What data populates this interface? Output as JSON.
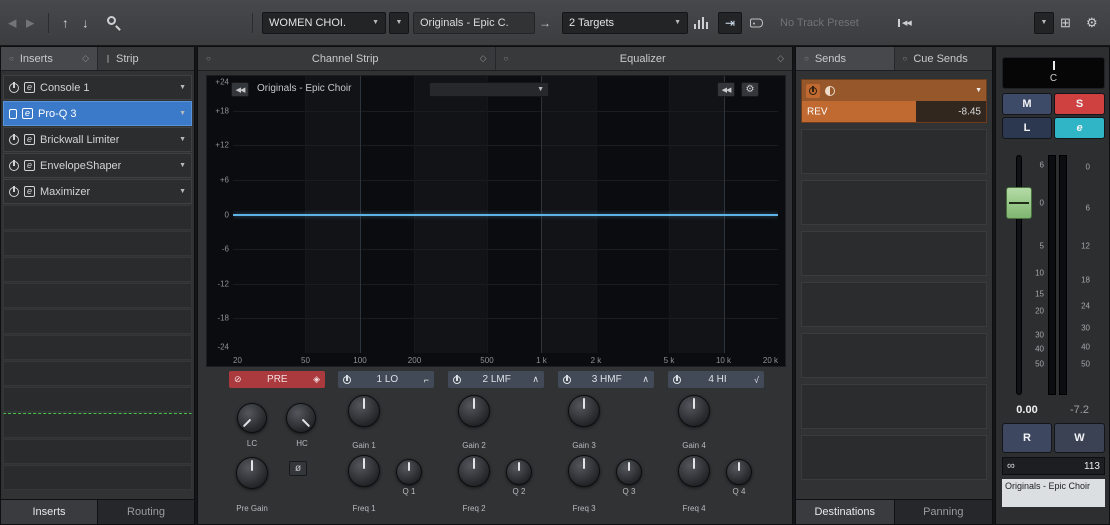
{
  "colors": {
    "selected_insert": "#3b79c9",
    "send_orange": "#c06a32",
    "send_orange_dark": "#96572b",
    "pre_red": "#aa3a3e",
    "eq_line": "#5fb3e4",
    "solo_red": "#cf4040",
    "mute_blue": "#3d4a68",
    "edit_cyan": "#2fb5c5",
    "fader_green": "#93ca85"
  },
  "icons": {
    "back": "◀",
    "forward": "▶",
    "up": "↑",
    "down": "↓",
    "dropdown": "▼",
    "arrow_right": "→",
    "insert_arrow": "⇥",
    "gear": "⚙",
    "skip_back": "◀◀",
    "circle": "○",
    "diamond": "◇",
    "strip": "∥",
    "e_btn": "e",
    "phase": "ø",
    "band_lo": "⌐",
    "band_peak": "∧",
    "band_hi": "√",
    "pre_bypass": "⊘",
    "pre_ab": "◈",
    "stereo": "∞",
    "window": "⊞"
  },
  "toolbar": {
    "channel_select": "WOMEN CHOI.",
    "preset_field": "Originals - Epic C.",
    "targets_select": "2 Targets",
    "no_track_preset": "No Track Preset"
  },
  "left_panel": {
    "tab_inserts": "Inserts",
    "tab_strip": "Strip",
    "inserts": [
      {
        "label": "Console 1"
      },
      {
        "label": "Pro-Q 3"
      },
      {
        "label": "Brickwall Limiter"
      },
      {
        "label": "EnvelopeShaper"
      },
      {
        "label": "Maximizer"
      }
    ],
    "bottom_tab_inserts": "Inserts",
    "bottom_tab_routing": "Routing"
  },
  "center_panel": {
    "tab_channel_strip": "Channel Strip",
    "tab_equalizer": "Equalizer",
    "eq_preset_label": "Originals - Epic Choir",
    "y_labels": [
      "+24",
      "+18",
      "+12",
      "+6",
      "0",
      "-6",
      "-12",
      "-18",
      "-24"
    ],
    "x_labels": [
      "20",
      "50",
      "100",
      "200",
      "500",
      "1 k",
      "2 k",
      "5 k",
      "10 k",
      "20 k"
    ],
    "pre": {
      "header": "PRE",
      "lc_label": "LC",
      "hc_label": "HC",
      "pregain_label": "Pre Gain"
    },
    "bands": [
      {
        "header": "1 LO",
        "gain_label": "Gain 1",
        "freq_label": "Freq 1",
        "q_label": "Q 1"
      },
      {
        "header": "2 LMF",
        "gain_label": "Gain 2",
        "freq_label": "Freq 2",
        "q_label": "Q 2"
      },
      {
        "header": "3 HMF",
        "gain_label": "Gain 3",
        "freq_label": "Freq 3",
        "q_label": "Q 3"
      },
      {
        "header": "4 HI",
        "gain_label": "Gain 4",
        "freq_label": "Freq 4",
        "q_label": "Q 4"
      }
    ]
  },
  "sends_panel": {
    "tab_sends": "Sends",
    "tab_cue_sends": "Cue Sends",
    "send1": {
      "name": "REV",
      "value": "-8.45"
    },
    "bottom_tab_destinations": "Destinations",
    "bottom_tab_panning": "Panning"
  },
  "fader_panel": {
    "pan": "C",
    "mute": "M",
    "solo": "S",
    "listen": "L",
    "edit": "e",
    "fader_scale": [
      "6",
      "0",
      "5",
      "10",
      "15",
      "20",
      "30",
      "40",
      "50"
    ],
    "meter_scale": [
      "0",
      "6",
      "12",
      "18",
      "24",
      "30",
      "40",
      "50"
    ],
    "gain": "0.00",
    "peak": "-7.2",
    "read": "R",
    "write": "W",
    "meter_value": "113",
    "track_name": "Originals - Epic Choir"
  }
}
